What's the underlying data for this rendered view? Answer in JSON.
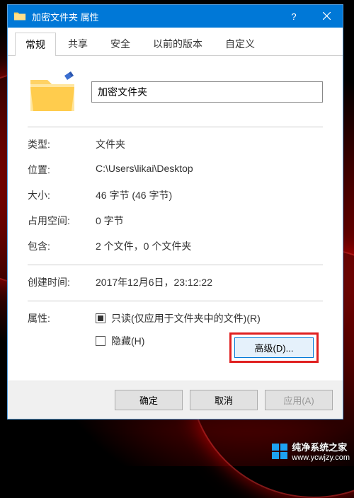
{
  "window": {
    "title": "加密文件夹 属性"
  },
  "tabs": [
    "常规",
    "共享",
    "安全",
    "以前的版本",
    "自定义"
  ],
  "folder_name": "加密文件夹",
  "props": {
    "type_label": "类型:",
    "type_value": "文件夹",
    "location_label": "位置:",
    "location_value": "C:\\Users\\likai\\Desktop",
    "size_label": "大小:",
    "size_value": "46 字节 (46 字节)",
    "sizeondisk_label": "占用空间:",
    "sizeondisk_value": "0 字节",
    "contains_label": "包含:",
    "contains_value": "2 个文件，0 个文件夹",
    "created_label": "创建时间:",
    "created_value": "2017年12月6日，23:12:22",
    "attr_label": "属性:",
    "readonly_label": "只读(仅应用于文件夹中的文件)(R)",
    "hidden_label": "隐藏(H)"
  },
  "buttons": {
    "advanced": "高级(D)...",
    "ok": "确定",
    "cancel": "取消",
    "apply": "应用(A)"
  },
  "watermark": {
    "name": "纯净系统之家",
    "url": "www.ycwjzy.com"
  }
}
